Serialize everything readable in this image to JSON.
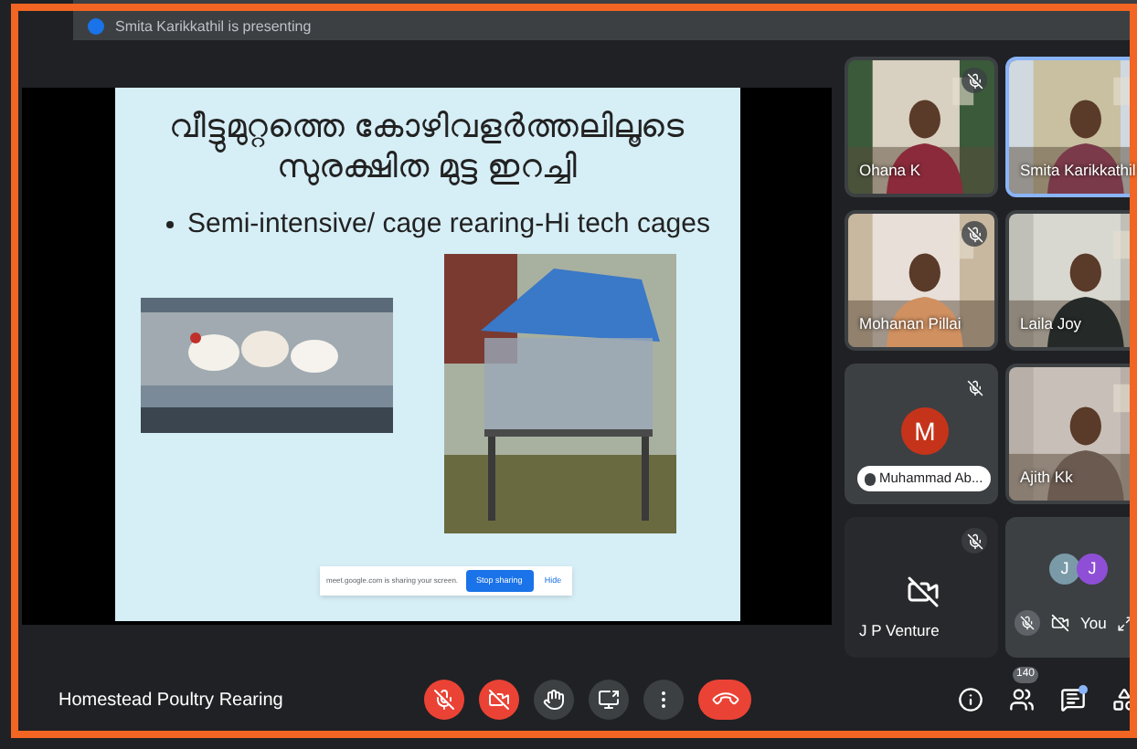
{
  "presenting_banner": "Smita Karikkathil is presenting",
  "slide": {
    "title_lines": [
      "വീട്ടുമുറ്റത്തെ കോഴിവളർത്തലിലൂടെ",
      "സുരക്ഷിത മുട്ട ഇറച്ചി"
    ],
    "bullet": "Semi-intensive/ cage rearing-Hi tech cages"
  },
  "share_bar": {
    "message": "meet.google.com is sharing your screen.",
    "stop_button": "Stop sharing",
    "hide_button": "Hide"
  },
  "participants": [
    {
      "name": "Ohana K",
      "kind": "video",
      "muted": true,
      "speaking": false
    },
    {
      "name": "Smita Karikkathil",
      "kind": "video",
      "muted": false,
      "speaking": true
    },
    {
      "name": "Mohanan Pillai",
      "kind": "video",
      "muted": true,
      "speaking": false
    },
    {
      "name": "Laila Joy",
      "kind": "video",
      "muted": false,
      "speaking": false
    },
    {
      "name": "Muhammad Ab...",
      "kind": "avatar",
      "initial": "M",
      "muted": true,
      "speaking": false
    },
    {
      "name": "Ajith Kk",
      "kind": "video",
      "muted": false,
      "speaking": false
    },
    {
      "name": "J P Venture",
      "kind": "camera_off",
      "muted": true,
      "speaking": false
    },
    {
      "name": "You",
      "kind": "self",
      "initials": [
        "J",
        "J"
      ],
      "muted": true,
      "speaking": false
    }
  ],
  "meeting_title": "Homestead Poultry Rearing",
  "controls": [
    {
      "kind": "mic",
      "off": true
    },
    {
      "kind": "camera",
      "off": true
    },
    {
      "kind": "hand",
      "off": false
    },
    {
      "kind": "present",
      "off": false
    },
    {
      "kind": "more",
      "off": false
    },
    {
      "kind": "leave"
    }
  ],
  "people_count": "140",
  "chat_unread": true
}
